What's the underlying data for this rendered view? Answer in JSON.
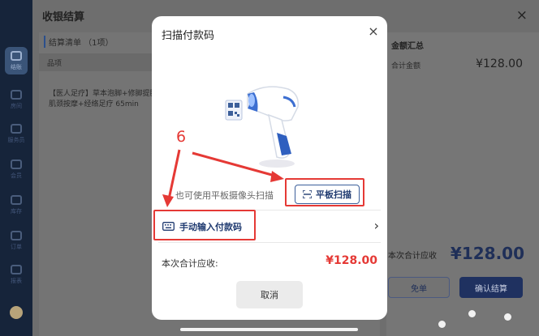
{
  "background": {
    "title": "收银结算",
    "close_icon": "×",
    "list_title": "结算清单 （1项）",
    "col_header": "品项",
    "item_text": "【医人足疗】草本泡脚+修脚提腿肌颈按摩+经络足疗 65min",
    "summary_title": "金额汇总",
    "subtotal_label": "合计金额",
    "subtotal_amount": "¥128.00",
    "total_label": "本次合计应收",
    "total_amount": "¥128.00",
    "waive_button": "免单",
    "confirm_button": "确认结算"
  },
  "nav": {
    "items": [
      {
        "label": "结账"
      },
      {
        "label": "房间"
      },
      {
        "label": "服务员"
      },
      {
        "label": "会员"
      },
      {
        "label": "库存"
      },
      {
        "label": "订单"
      },
      {
        "label": "报表"
      }
    ]
  },
  "modal": {
    "title": "扫描付款码",
    "close_icon": "×",
    "hint": "也可使用平板摄像头扫描",
    "tablet_scan_button": "平板扫描",
    "manual_input_label": "手动输入付款码",
    "chevron": "›",
    "total_label": "本次合计应收:",
    "total_amount": "¥128.00",
    "cancel_button": "取消"
  },
  "annotation": {
    "step_number": "6",
    "color": "#e53935"
  },
  "colors": {
    "accent": "#1f3a70",
    "price_red": "#e53935",
    "nav_bg": "#16243a"
  }
}
